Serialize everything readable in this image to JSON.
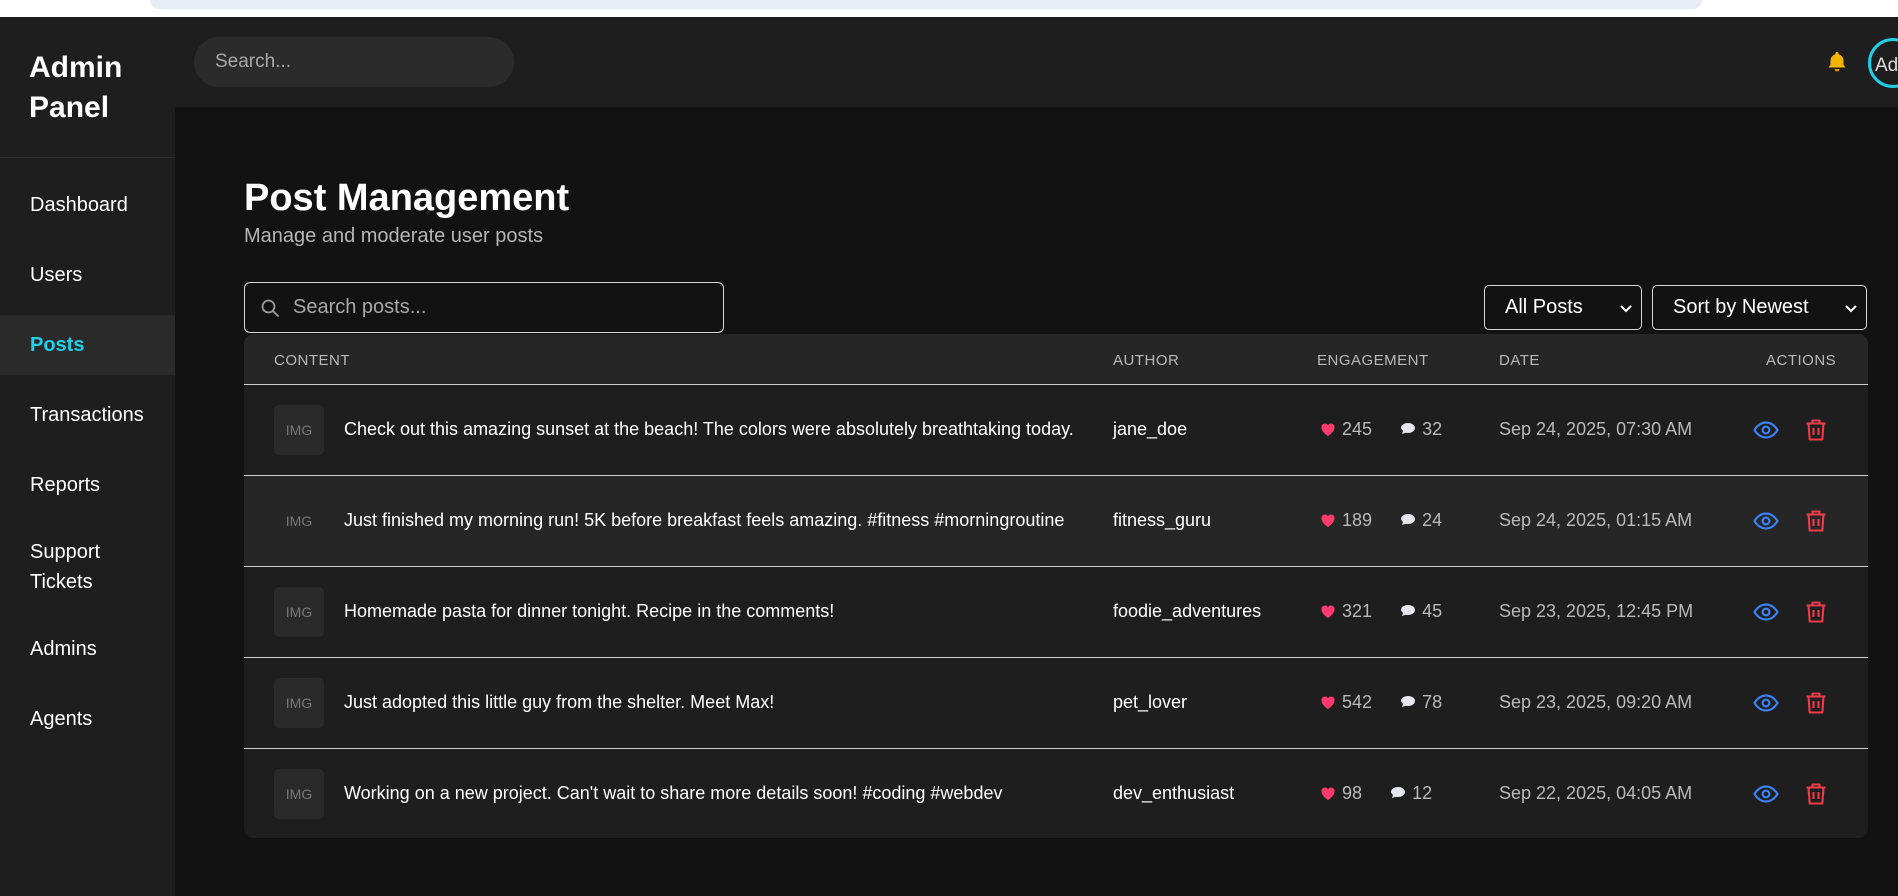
{
  "brand": {
    "title": "Admin Panel"
  },
  "sidebar": {
    "items": [
      {
        "label": "Dashboard",
        "active": false
      },
      {
        "label": "Users",
        "active": false
      },
      {
        "label": "Posts",
        "active": true
      },
      {
        "label": "Transactions",
        "active": false
      },
      {
        "label": "Reports",
        "active": false
      },
      {
        "label": "Support Tickets",
        "active": false
      },
      {
        "label": "Admins",
        "active": false
      },
      {
        "label": "Agents",
        "active": false
      }
    ]
  },
  "header": {
    "search_placeholder": "Search...",
    "avatar_alt": "Admin"
  },
  "page": {
    "title": "Post Management",
    "subtitle": "Manage and moderate user posts",
    "search_placeholder": "Search posts...",
    "filter_value": "All Posts",
    "sort_value": "Sort by Newest"
  },
  "table": {
    "columns": [
      "CONTENT",
      "AUTHOR",
      "ENGAGEMENT",
      "DATE",
      "ACTIONS"
    ],
    "thumb_label": "IMG",
    "rows": [
      {
        "content": "Check out this amazing sunset at the beach! The colors were absolutely breathtaking today.",
        "author": "jane_doe",
        "likes": "245",
        "comments": "32",
        "date": "Sep 24, 2025, 07:30 AM"
      },
      {
        "content": "Just finished my morning run! 5K before breakfast feels amazing. #fitness #morningroutine",
        "author": "fitness_guru",
        "likes": "189",
        "comments": "24",
        "date": "Sep 24, 2025, 01:15 AM"
      },
      {
        "content": "Homemade pasta for dinner tonight. Recipe in the comments!",
        "author": "foodie_adventures",
        "likes": "321",
        "comments": "45",
        "date": "Sep 23, 2025, 12:45 PM"
      },
      {
        "content": "Just adopted this little guy from the shelter. Meet Max!",
        "author": "pet_lover",
        "likes": "542",
        "comments": "78",
        "date": "Sep 23, 2025, 09:20 AM"
      },
      {
        "content": "Working on a new project. Can't wait to share more details soon! #coding #webdev",
        "author": "dev_enthusiast",
        "likes": "98",
        "comments": "12",
        "date": "Sep 22, 2025, 04:05 AM"
      }
    ]
  },
  "colors": {
    "accent": "#1fd0e8",
    "view_action": "#3b82f6",
    "delete_action": "#ef3b4a",
    "like": "#ff3b6b"
  }
}
